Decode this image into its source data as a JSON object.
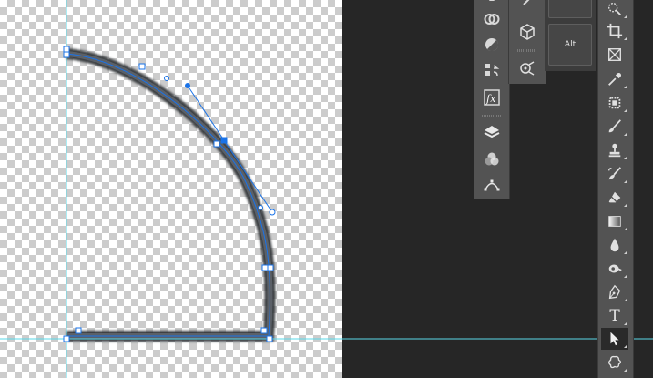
{
  "document": {
    "guides": {
      "color": "#5ad8e8"
    },
    "path": {
      "stroke": "#3f4348",
      "selection_color": "#1a73e8"
    }
  },
  "option_panel": {
    "alt_label": "Alt"
  },
  "panels_left": [
    {
      "name": "history-icon"
    },
    {
      "name": "cc-libraries-icon"
    },
    {
      "name": "adjustments-icon"
    },
    {
      "name": "properties-icon"
    },
    {
      "name": "styles-fx-icon"
    },
    {
      "name": "layers-icon"
    },
    {
      "name": "channels-icon"
    },
    {
      "name": "paths-icon"
    }
  ],
  "panels_right": [
    {
      "name": "brush-icon"
    },
    {
      "name": "3d-cube-icon"
    },
    {
      "name": "timeline-icon"
    }
  ],
  "tools": [
    {
      "name": "quick-selection-tool-icon"
    },
    {
      "name": "crop-tool-icon"
    },
    {
      "name": "frame-tool-icon"
    },
    {
      "name": "eyedropper-tool-icon"
    },
    {
      "name": "spot-healing-tool-icon"
    },
    {
      "name": "brush-tool-icon"
    },
    {
      "name": "clone-stamp-tool-icon"
    },
    {
      "name": "history-brush-tool-icon"
    },
    {
      "name": "eraser-tool-icon"
    },
    {
      "name": "gradient-tool-icon"
    },
    {
      "name": "blur-tool-icon"
    },
    {
      "name": "dodge-tool-icon"
    },
    {
      "name": "pen-tool-icon"
    },
    {
      "name": "type-tool-icon",
      "glyph": "T"
    },
    {
      "name": "path-selection-tool-icon",
      "active": true
    },
    {
      "name": "custom-shape-tool-icon"
    }
  ]
}
